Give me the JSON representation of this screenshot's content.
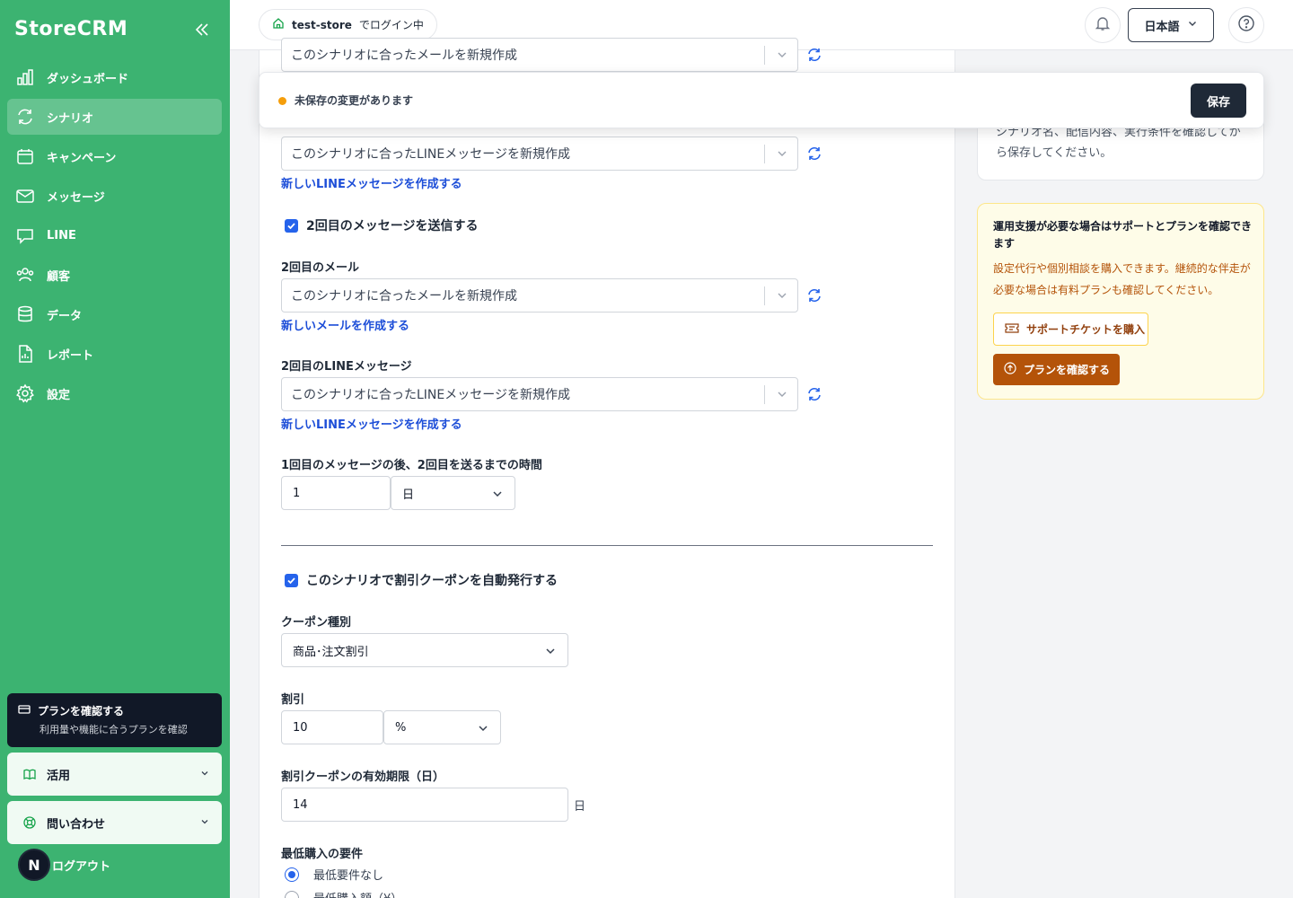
{
  "app": {
    "name": "StoreCRM"
  },
  "sidebar": {
    "items": [
      {
        "label": "ダッシュボード",
        "icon": "chart-bar-icon",
        "active": false
      },
      {
        "label": "シナリオ",
        "icon": "refresh-icon",
        "active": true
      },
      {
        "label": "キャンペーン",
        "icon": "calendar-icon",
        "active": false
      },
      {
        "label": "メッセージ",
        "icon": "mail-icon",
        "active": false
      },
      {
        "label": "LINE",
        "icon": "chat-bubble-icon",
        "active": false
      },
      {
        "label": "顧客",
        "icon": "users-icon",
        "active": false
      },
      {
        "label": "データ",
        "icon": "database-icon",
        "active": false
      },
      {
        "label": "レポート",
        "icon": "document-icon",
        "active": false
      },
      {
        "label": "設定",
        "icon": "gear-icon",
        "active": false
      }
    ],
    "plan_card": {
      "title": "プランを確認する",
      "subtitle": "利用量や機能に合うプランを確認"
    },
    "usage_label": "活用",
    "contact_label": "問い合わせ",
    "avatar_initial": "N",
    "logout_label": "ログアウト",
    "color": "#3cb371"
  },
  "header": {
    "store_name": "test-store",
    "store_suffix": "でログイン中",
    "language": "日本語"
  },
  "banner": {
    "text": "未保存の変更があります",
    "save_label": "保存"
  },
  "form": {
    "first_email_value": "このシナリオに合ったメールを新規作成",
    "first_line_value": "このシナリオに合ったLINEメッセージを新規作成",
    "new_line_link": "新しいLINEメッセージを作成する",
    "second_message_checkbox": "2回目のメッセージを送信する",
    "second_email_label": "2回目のメール",
    "second_email_value": "このシナリオに合ったメールを新規作成",
    "new_email_link": "新しいメールを作成する",
    "second_line_label": "2回目のLINEメッセージ",
    "second_line_value": "このシナリオに合ったLINEメッセージを新規作成",
    "new_line_link_2": "新しいLINEメッセージを作成する",
    "interval_label": "1回目のメッセージの後、2回目を送るまでの時間",
    "interval_value": "1",
    "interval_unit": "日",
    "coupon_checkbox": "このシナリオで割引クーポンを自動発行する",
    "coupon_type_label": "クーポン種別",
    "coupon_type_value": "商品･注文割引",
    "discount_label": "割引",
    "discount_value": "10",
    "discount_unit": "%",
    "expiry_label": "割引クーポンの有効期限（日）",
    "expiry_value": "14",
    "expiry_suffix": "日",
    "min_purchase_label": "最低購入の要件",
    "min_options": [
      "最低要件なし",
      "最低購入額（¥）"
    ]
  },
  "right": {
    "info_body": "シナリオ名、配信内容、実行条件を確認してから保存してください。",
    "support_title": "運用支援が必要な場合はサポートとプランを確認できます",
    "support_body": "設定代行や個別相談を購入できます。継続的な伴走が必要な場合は有料プランも確認してください。",
    "ticket_button": "サポートチケットを購入",
    "plan_button": "プランを確認する"
  }
}
